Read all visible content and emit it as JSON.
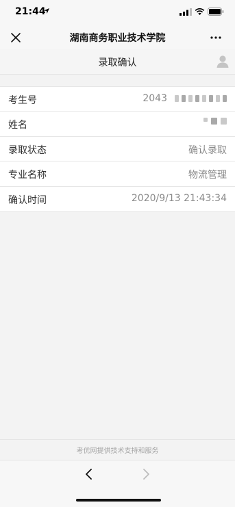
{
  "status_bar": {
    "time": "21:44",
    "icons": [
      "location-arrow-icon",
      "cellular-signal-icon",
      "wifi-icon",
      "battery-icon"
    ]
  },
  "nav": {
    "title": "湖南商务职业技术学院",
    "close_icon": "close-icon",
    "more_icon": "more-icon"
  },
  "page": {
    "title": "录取确认",
    "user_icon": "user-icon"
  },
  "rows": [
    {
      "label": "考生号",
      "value": "2043",
      "masked": true
    },
    {
      "label": "姓名",
      "value": "",
      "masked": true
    },
    {
      "label": "录取状态",
      "value": "确认录取",
      "masked": false
    },
    {
      "label": "专业名称",
      "value": "物流管理",
      "masked": false
    },
    {
      "label": "确认时间",
      "value": "2020/9/13 21:43:34",
      "masked": false
    }
  ],
  "footer": {
    "text": "考优网提供技术支持和服务"
  },
  "toolbar": {
    "back_icon": "chevron-left-icon",
    "forward_icon": "chevron-right-icon",
    "forward_enabled": false
  },
  "colors": {
    "background": "#f3f3f3",
    "card": "#ffffff",
    "label_text": "#333333",
    "value_text": "#8a8a8a",
    "footer_text": "#a5a5a5"
  }
}
